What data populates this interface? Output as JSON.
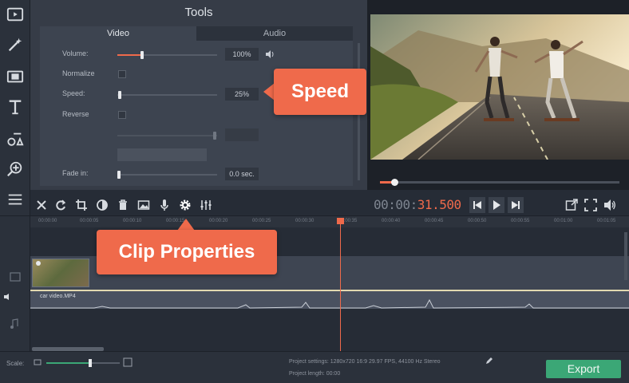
{
  "tools_panel": {
    "title": "Tools",
    "tabs": [
      {
        "label": "Video",
        "active": true
      },
      {
        "label": "Audio",
        "active": false
      }
    ],
    "properties": {
      "volume": {
        "label": "Volume:",
        "value": "100%",
        "level": 0.25
      },
      "normalize": {
        "label": "Normalize"
      },
      "speed": {
        "label": "Speed:",
        "value": "25%",
        "level": 0.02
      },
      "reverse": {
        "label": "Reverse"
      },
      "fade_in": {
        "label": "Fade in:",
        "value": "0.0 sec.",
        "level": 0.0
      }
    }
  },
  "toolbar": {
    "timecode_dim": "00:00:",
    "timecode_accent": "31.500"
  },
  "timeline": {
    "audio_clip_label": "car video.MP4"
  },
  "callouts": {
    "speed": "Speed",
    "clip_properties": "Clip Properties"
  },
  "footer": {
    "scale_label": "Scale:",
    "project_settings": "Project settings: 1280x720 16:9 29.97 FPS, 44100 Hz Stereo",
    "project_length": "Project length: 00:00",
    "export_label": "Export"
  },
  "colors": {
    "accent": "#ef6a4b",
    "export_green": "#3ba776",
    "panel_bg": "#363c47",
    "app_bg": "#262c36"
  }
}
